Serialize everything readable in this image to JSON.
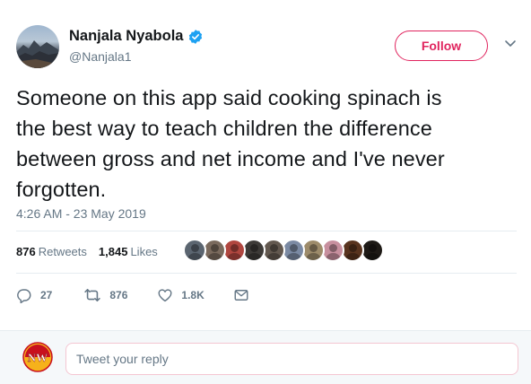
{
  "author": {
    "name": "Nanjala Nyabola",
    "handle": "@Nanjala1",
    "verified": true,
    "avatar_icon": "mountain-landscape-avatar"
  },
  "header": {
    "follow_label": "Follow",
    "menu_icon": "chevron-down-icon"
  },
  "tweet": {
    "lines": [
      "Someone on this app said cooking spinach is",
      "the best way to teach children the difference",
      "between gross and net income and I've never",
      "forgotten."
    ],
    "timestamp": "4:26 AM - 23 May 2019"
  },
  "stats": {
    "retweets_count": "876",
    "retweets_label": "Retweets",
    "likes_count": "1,845",
    "likes_label": "Likes",
    "likers": [
      {
        "color": "#5b6570"
      },
      {
        "color": "#7a6a5d"
      },
      {
        "color": "#b0463f"
      },
      {
        "color": "#3d3a37"
      },
      {
        "color": "#62584f"
      },
      {
        "color": "#7b8aa3"
      },
      {
        "color": "#9d8b6a"
      },
      {
        "color": "#c78f9e"
      },
      {
        "color": "#58331e"
      },
      {
        "color": "#1e1a16"
      }
    ]
  },
  "actions": {
    "reply_count": "27",
    "retweet_count": "876",
    "like_count": "1.8K"
  },
  "reply": {
    "placeholder": "Tweet your reply",
    "logo_text": "NW"
  },
  "colors": {
    "accent_red": "#e0245e",
    "verified_blue": "#1da1f2",
    "muted_gray": "#657786"
  }
}
